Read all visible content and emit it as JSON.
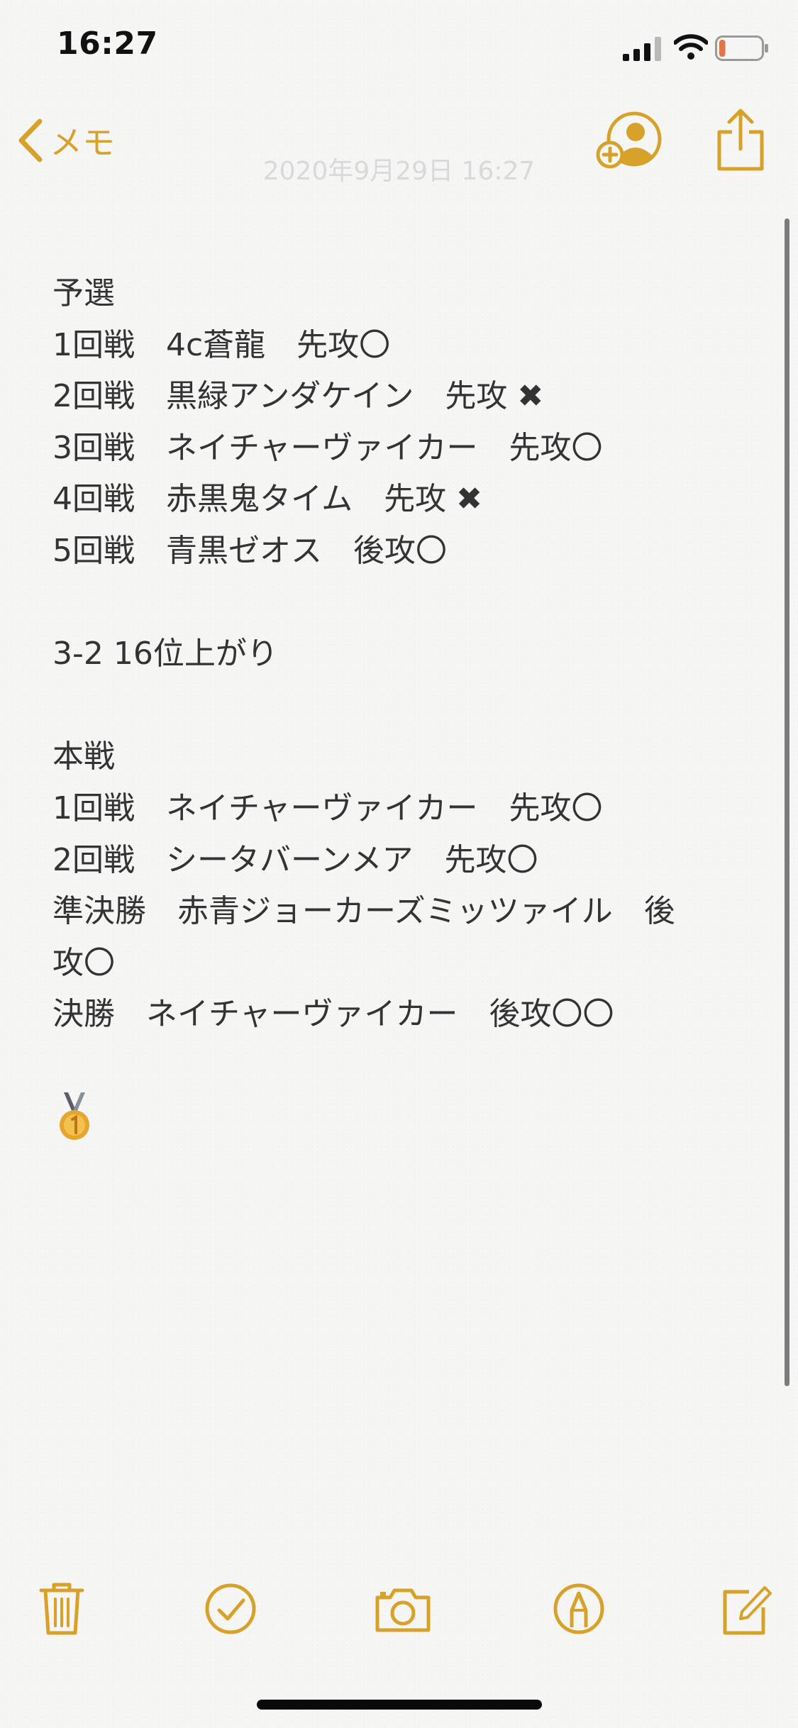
{
  "status_bar": {
    "time": "16:27",
    "battery_level": 0.15
  },
  "nav": {
    "back_label": "メモ",
    "note_date": "2020年9月29日 16:27"
  },
  "note": {
    "lines": [
      "予選",
      "1回戦　4c蒼龍　先攻〇",
      "2回戦　黒緑アンダケイン　先攻 ✖",
      "3回戦　ネイチャーヴァイカー　先攻〇",
      "4回戦　赤黒鬼タイム　先攻 ✖",
      "5回戦　青黒ゼオス　後攻〇",
      "",
      "3-2 16位上がり",
      "",
      "本戦",
      "1回戦　ネイチャーヴァイカー　先攻〇",
      "2回戦　シータバーンメア　先攻〇",
      "準決勝　赤青ジョーカーズミッツァイル　後",
      "攻〇",
      "決勝　ネイチャーヴァイカー　後攻〇〇"
    ],
    "medal_icon": "first-place-medal"
  },
  "toolbar": {
    "icons": [
      "trash-icon",
      "checklist-icon",
      "camera-icon",
      "markup-icon",
      "compose-icon"
    ]
  },
  "colors": {
    "accent": "#d8a12a",
    "battery_low": "#e0754a"
  }
}
